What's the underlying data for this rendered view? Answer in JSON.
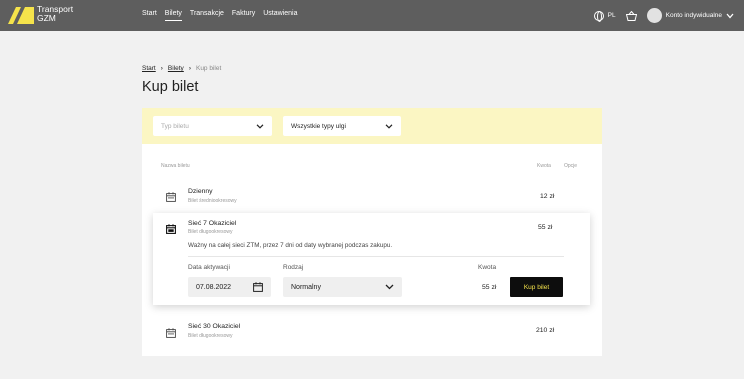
{
  "brand": {
    "line1": "Transport",
    "line2": "GZM",
    "accent": "#f5e34b"
  },
  "nav": [
    {
      "label": "Start",
      "active": false
    },
    {
      "label": "Bilety",
      "active": true
    },
    {
      "label": "Transakcje",
      "active": false
    },
    {
      "label": "Faktury",
      "active": false
    },
    {
      "label": "Ustawienia",
      "active": false
    }
  ],
  "header_tools": {
    "language": "PL",
    "account_label": "Konto indywidualne"
  },
  "breadcrumb": {
    "start": "Start",
    "bilety": "Bilety",
    "current": "Kup bilet"
  },
  "page_title": "Kup bilet",
  "filters": {
    "ticket_type_placeholder": "Typ biletu",
    "discount_type": "Wszystkie typy ulgi"
  },
  "table": {
    "headers": {
      "name": "Nazwa biletu",
      "amount": "Kwota",
      "options": "Opcje"
    },
    "rows": [
      {
        "name": "Dzienny",
        "subtitle": "Bilet średniookresowy",
        "amount": "12 zł"
      },
      {
        "name": "Sieć 30 Okaziciel",
        "subtitle": "Bilet długookresowy",
        "amount": "210 zł"
      }
    ]
  },
  "expanded": {
    "name": "Sieć 7 Okaziciel",
    "subtitle": "Bilet długookresowy",
    "amount": "55 zł",
    "description": "Ważny na całej sieci ZTM, przez 7 dni od daty wybranej podczas zakupu.",
    "activation_label": "Data aktywacji",
    "activation_value": "07.08.2022",
    "type_label": "Rodzaj",
    "type_value": "Normalny",
    "amount_label": "Kwota",
    "amount_value": "55 zł",
    "buy_button": "Kup bilet"
  }
}
